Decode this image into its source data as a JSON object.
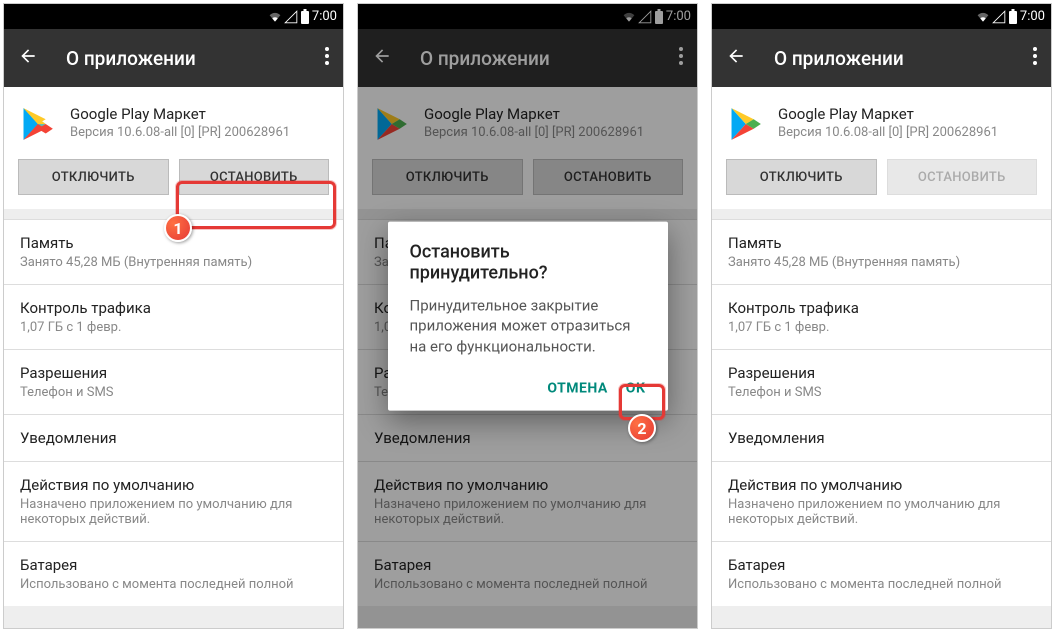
{
  "status": {
    "time": "7:00"
  },
  "appbar": {
    "title": "О приложении"
  },
  "app": {
    "name": "Google Play Маркет",
    "version": "Версия 10.6.08-all [0] [PR] 200628961"
  },
  "buttons": {
    "disable": "ОТКЛЮЧИТЬ",
    "stop": "ОСТАНОВИТЬ"
  },
  "items": {
    "storage": {
      "title": "Память",
      "sub": "Занято 45,28  МБ (Внутренняя память)"
    },
    "data": {
      "title": "Контроль трафика",
      "sub": "1,07  ГБ с 1 февр."
    },
    "perm": {
      "title": "Разрешения",
      "sub": "Телефон и SMS"
    },
    "notif": {
      "title": "Уведомления"
    },
    "default": {
      "title": "Действия по умолчанию",
      "sub": "Назначено приложением по умолчанию для некоторых действий."
    },
    "battery": {
      "title": "Батарея",
      "sub": "Использовано с момента последней полной"
    }
  },
  "dialog": {
    "title": "Остановить принудительно?",
    "text": "Принудительное закрытие приложения может отразиться на его функциональности.",
    "cancel": "ОТМЕНА",
    "ok": "ОК"
  },
  "badges": {
    "one": "1",
    "two": "2"
  }
}
